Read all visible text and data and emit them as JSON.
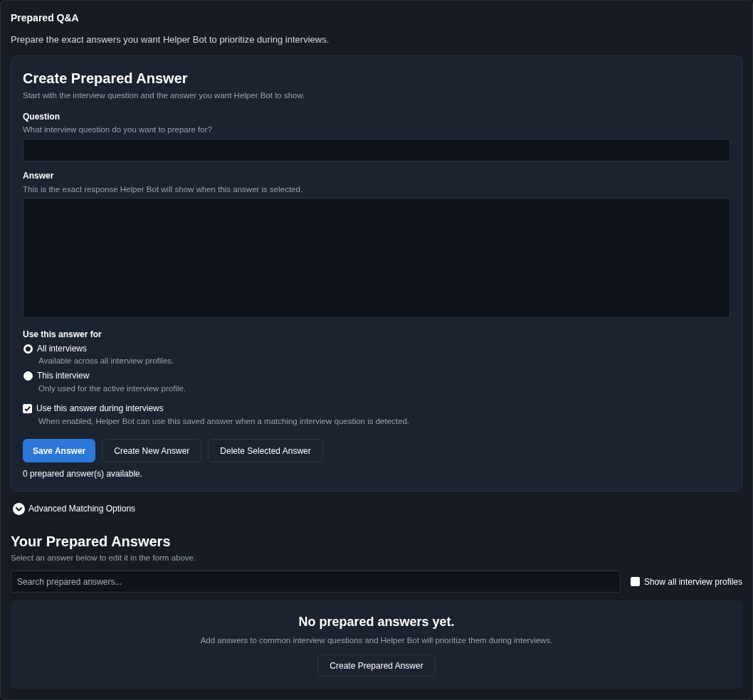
{
  "page": {
    "title": "Prepared Q&A",
    "subtitle": "Prepare the exact answers you want Helper Bot to prioritize during interviews."
  },
  "form": {
    "title": "Create Prepared Answer",
    "subtitle": "Start with the interview question and the answer you want Helper Bot to show.",
    "fields": [
      {
        "kind": "input",
        "label": "Question",
        "hint": "What interview question do you want to prepare for?"
      },
      {
        "kind": "textarea",
        "label": "Answer",
        "hint": "This is the exact response Helper Bot will show when this answer is selected."
      }
    ],
    "scope": {
      "label": "Use this answer for",
      "options": [
        {
          "label": "All interviews",
          "description": "Available across all interview profiles.",
          "selected": true
        },
        {
          "label": "This interview",
          "description": "Only used for the active interview profile.",
          "selected": false
        }
      ]
    },
    "enable": {
      "label": "Use this answer during interviews",
      "description": "When enabled, Helper Bot can use this saved answer when a matching interview question is detected.",
      "checked": true
    },
    "buttons": [
      {
        "kind": "primary",
        "label": "Save Answer"
      },
      {
        "kind": "secondary",
        "label": "Create New Answer"
      },
      {
        "kind": "secondary",
        "label": "Delete Selected Answer"
      }
    ],
    "count": "0 prepared answer(s) available."
  },
  "advanced": {
    "label": "Advanced Matching Options",
    "expanded": false
  },
  "answers": {
    "title": "Your Prepared Answers",
    "subtitle": "Select an answer below to edit it in the form above.",
    "search": {
      "placeholder": "Search prepared answers..."
    },
    "show_all": {
      "label": "Show all interview profiles",
      "checked": false
    },
    "empty": {
      "title": "No prepared answers yet.",
      "message": "Add answers to common interview questions and Helper Bot will prioritize them during interviews.",
      "button": "Create Prepared Answer"
    }
  }
}
